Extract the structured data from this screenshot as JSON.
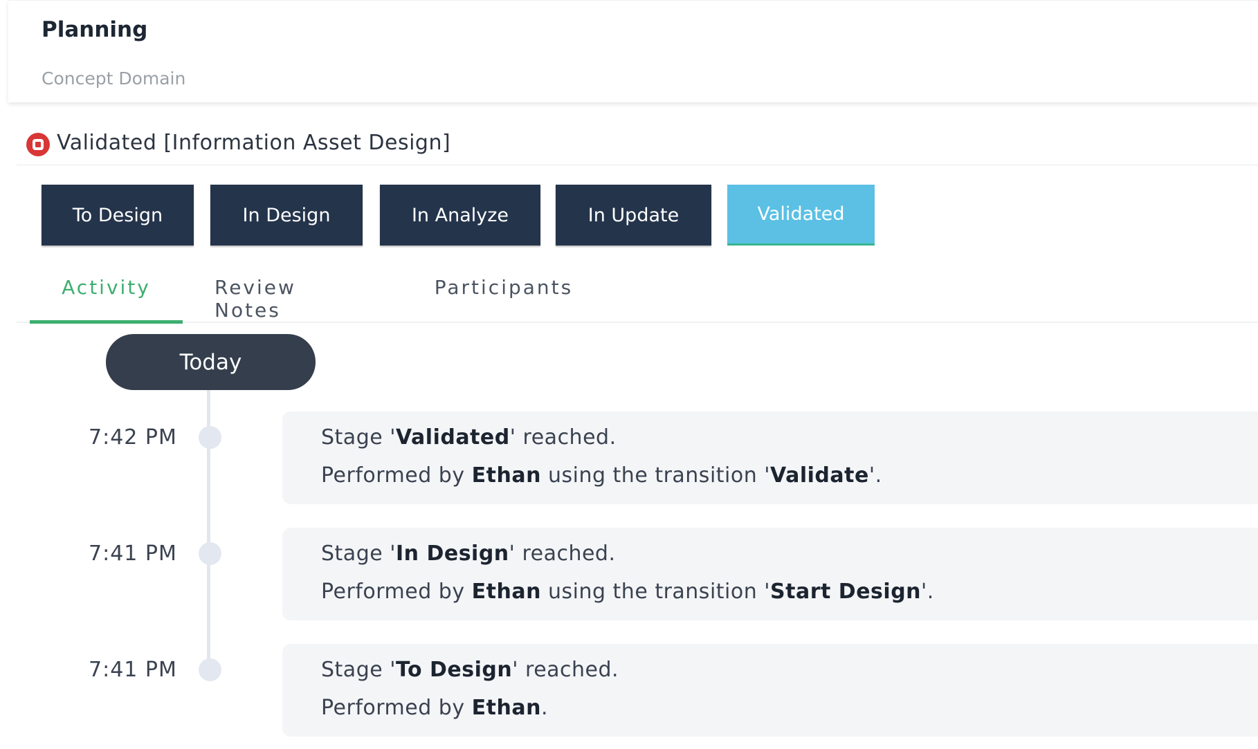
{
  "header": {
    "title": "Planning",
    "subtitle": "Concept Domain"
  },
  "stage": {
    "status_icon": "stop-circle-icon",
    "status_color": "#d93636",
    "label": "Validated [Information Asset Design]"
  },
  "transitions": [
    {
      "label": "To Design",
      "active": false
    },
    {
      "label": "In Design",
      "active": false
    },
    {
      "label": "In Analyze",
      "active": false
    },
    {
      "label": "In Update",
      "active": false
    },
    {
      "label": "Validated",
      "active": true
    }
  ],
  "tabs": [
    {
      "label": "Activity",
      "active": true
    },
    {
      "label": "Review Notes",
      "active": false
    },
    {
      "label": "Participants",
      "active": false
    }
  ],
  "timeline": {
    "group_label": "Today",
    "events": [
      {
        "time": "7:42 PM",
        "stage_prefix": "Stage '",
        "stage_name": "Validated",
        "stage_suffix": "' reached.",
        "by_prefix": "Performed by ",
        "user": "Ethan",
        "transition_prefix": " using the transition '",
        "transition": "Validate",
        "transition_suffix": "'."
      },
      {
        "time": "7:41 PM",
        "stage_prefix": "Stage '",
        "stage_name": "In Design",
        "stage_suffix": "' reached.",
        "by_prefix": "Performed by ",
        "user": "Ethan",
        "transition_prefix": " using the transition '",
        "transition": "Start Design",
        "transition_suffix": "'."
      },
      {
        "time": "7:41 PM",
        "stage_prefix": "Stage '",
        "stage_name": "To Design",
        "stage_suffix": "' reached.",
        "by_prefix": "Performed by ",
        "user": "Ethan",
        "end_suffix": "."
      }
    ]
  },
  "colors": {
    "button_dark": "#24344b",
    "button_active": "#5bc0e4",
    "tab_active": "#3dae6f",
    "pill": "#343e4c"
  }
}
